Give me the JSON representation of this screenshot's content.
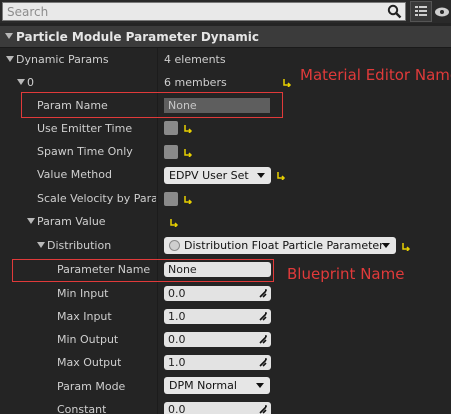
{
  "search": {
    "placeholder": "Search"
  },
  "category": {
    "title": "Particle Module Parameter Dynamic"
  },
  "rows": [
    {
      "label": "Dynamic Params",
      "value": "4 elements"
    },
    {
      "label": "0",
      "value": "6 members"
    },
    {
      "label": "Param Name",
      "value": "None"
    },
    {
      "label": "Use Emitter Time"
    },
    {
      "label": "Spawn Time Only"
    },
    {
      "label": "Value Method",
      "value": "EDPV User Set"
    },
    {
      "label": "Scale Velocity by Param"
    },
    {
      "label": "Param Value"
    },
    {
      "label": "Distribution",
      "value": "Distribution Float Particle Parameter"
    },
    {
      "label": "Parameter Name",
      "value": "None"
    },
    {
      "label": "Min Input",
      "value": "0.0"
    },
    {
      "label": "Max Input",
      "value": "1.0"
    },
    {
      "label": "Min Output",
      "value": "0.0"
    },
    {
      "label": "Max Output",
      "value": "1.0"
    },
    {
      "label": "Param Mode",
      "value": "DPM Normal"
    },
    {
      "label": "Constant",
      "value": "0.0"
    }
  ],
  "annotations": {
    "material_editor": "Material Editor Name",
    "blueprint": "Blueprint Name"
  },
  "colors": {
    "annotation": "#e03a3a",
    "reset_arrow": "#e8d000"
  }
}
